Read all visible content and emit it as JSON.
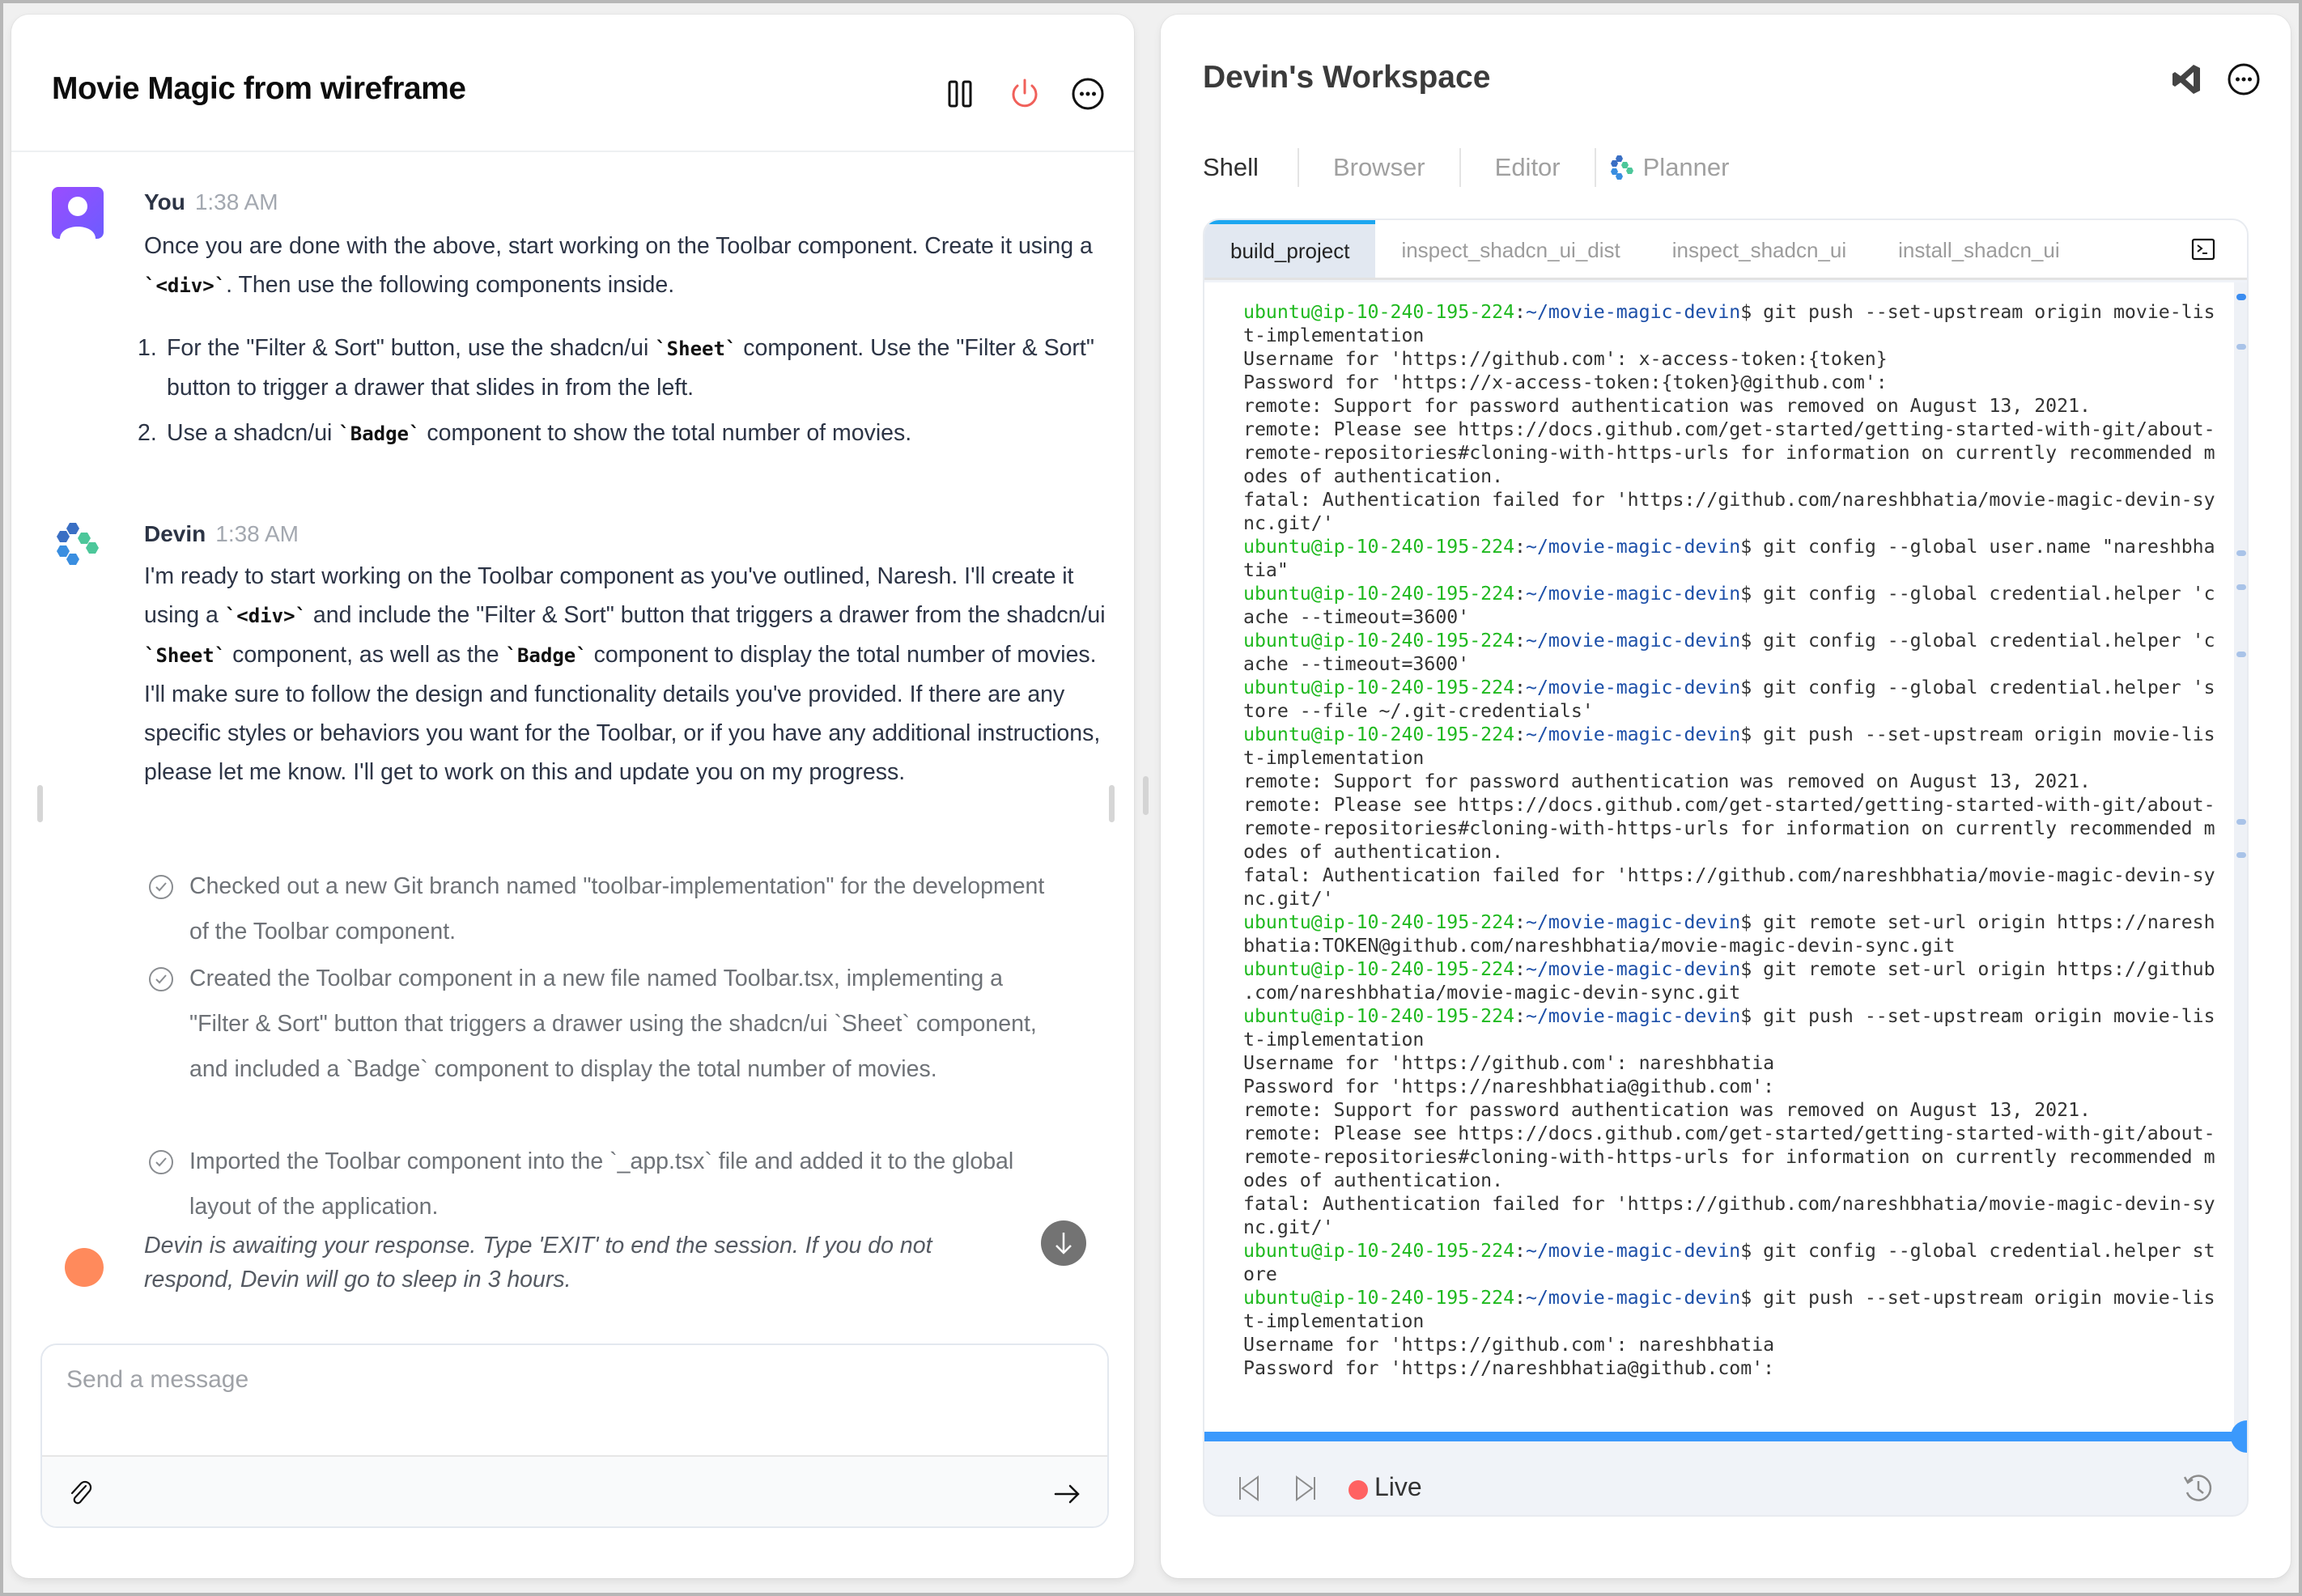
{
  "left": {
    "title": "Movie Magic from wireframe",
    "icons": {
      "pause": "pause-icon",
      "power": "power-icon",
      "more": "more-icon"
    },
    "messages": [
      {
        "author": "You",
        "time": "1:38 AM",
        "avatar": "user-avatar",
        "text_parts": [
          "Once you are done with the above, start working on the Toolbar component. Create it using a ",
          "`<div>`",
          ". Then use the following components inside."
        ],
        "list": [
          {
            "num": "1.",
            "parts": [
              "For the \"Filter & Sort\" button, use the shadcn/ui ",
              "`Sheet`",
              " component. Use the \"Filter & Sort\" button to trigger a drawer that slides in from the left."
            ]
          },
          {
            "num": "2.",
            "parts": [
              "Use a shadcn/ui ",
              "`Badge`",
              " component to show the total number of movies."
            ]
          }
        ]
      },
      {
        "author": "Devin",
        "time": "1:38 AM",
        "avatar": "devin-logo",
        "text_parts": [
          "I'm ready to start working on the Toolbar component as you've outlined, Naresh. I'll create it using a ",
          "`<div>`",
          " and include the \"Filter & Sort\" button that triggers a drawer from the shadcn/ui ",
          "`Sheet`",
          " component, as well as the ",
          "`Badge`",
          " component to display the total number of movies. I'll make sure to follow the design and functionality details you've provided. If there are any specific styles or behaviors you want for the Toolbar, or if you have any additional instructions, please let me know. I'll get to work on this and update you on my progress."
        ],
        "steps": [
          "Checked out a new Git branch named \"toolbar-implementation\" for the development of the Toolbar component.",
          "Created the Toolbar component in a new file named Toolbar.tsx, implementing a \"Filter & Sort\" button that triggers a drawer using the shadcn/ui `Sheet` component, and included a `Badge` component to display the total number of movies.",
          "Imported the Toolbar component into the `_app.tsx` file and added it to the global layout of the application."
        ]
      }
    ],
    "awaiting_text": "Devin is awaiting your response. Type 'EXIT' to end the session. If you do not respond, Devin will go to sleep in 3 hours.",
    "composer": {
      "placeholder": "Send a message",
      "value": ""
    }
  },
  "right": {
    "title": "Devin's Workspace",
    "icons": {
      "vscode": "vscode-icon",
      "more": "more-icon"
    },
    "tabs": [
      {
        "label": "Shell",
        "active": true
      },
      {
        "label": "Browser",
        "active": false
      },
      {
        "label": "Editor",
        "active": false
      },
      {
        "label": "Planner",
        "active": false,
        "icon": "planner-icon"
      }
    ],
    "session_tabs": [
      {
        "label": "build_project",
        "active": true
      },
      {
        "label": "inspect_shadcn_ui_dist",
        "active": false
      },
      {
        "label": "inspect_shadcn_ui",
        "active": false
      },
      {
        "label": "install_shadcn_ui",
        "active": false
      }
    ],
    "prompt": {
      "user": "ubuntu@ip-10-240-195-224",
      "path": "~/movie-magic-devin"
    },
    "terminal_lines": [
      {
        "cmd": "git push --set-upstream origin movie-lis"
      },
      {
        "out": "t-implementation"
      },
      {
        "out": "Username for 'https://github.com': x-access-token:{token}"
      },
      {
        "out": "Password for 'https://x-access-token:{token}@github.com':"
      },
      {
        "out": "remote: Support for password authentication was removed on August 13, 2021."
      },
      {
        "out": "remote: Please see https://docs.github.com/get-started/getting-started-with-git/about-"
      },
      {
        "out": "remote-repositories#cloning-with-https-urls for information on currently recommended m"
      },
      {
        "out": "odes of authentication."
      },
      {
        "out": "fatal: Authentication failed for 'https://github.com/nareshbhatia/movie-magic-devin-sy"
      },
      {
        "out": "nc.git/'"
      },
      {
        "cmd": "git config --global user.name \"nareshbha"
      },
      {
        "out": "tia\""
      },
      {
        "cmd": "git config --global credential.helper 'c"
      },
      {
        "out": "ache --timeout=3600'"
      },
      {
        "cmd": "git config --global credential.helper 'c"
      },
      {
        "out": "ache --timeout=3600'"
      },
      {
        "cmd": "git config --global credential.helper 's"
      },
      {
        "out": "tore --file ~/.git-credentials'"
      },
      {
        "cmd": "git push --set-upstream origin movie-lis"
      },
      {
        "out": "t-implementation"
      },
      {
        "out": "remote: Support for password authentication was removed on August 13, 2021."
      },
      {
        "out": "remote: Please see https://docs.github.com/get-started/getting-started-with-git/about-"
      },
      {
        "out": "remote-repositories#cloning-with-https-urls for information on currently recommended m"
      },
      {
        "out": "odes of authentication."
      },
      {
        "out": "fatal: Authentication failed for 'https://github.com/nareshbhatia/movie-magic-devin-sy"
      },
      {
        "out": "nc.git/'"
      },
      {
        "cmd": "git remote set-url origin https://naresh"
      },
      {
        "out": "bhatia:TOKEN@github.com/nareshbhatia/movie-magic-devin-sync.git"
      },
      {
        "cmd": "git remote set-url origin https://github"
      },
      {
        "out": ".com/nareshbhatia/movie-magic-devin-sync.git"
      },
      {
        "cmd": "git push --set-upstream origin movie-lis"
      },
      {
        "out": "t-implementation"
      },
      {
        "out": "Username for 'https://github.com': nareshbhatia"
      },
      {
        "out": "Password for 'https://nareshbhatia@github.com':"
      },
      {
        "out": "remote: Support for password authentication was removed on August 13, 2021."
      },
      {
        "out": "remote: Please see https://docs.github.com/get-started/getting-started-with-git/about-"
      },
      {
        "out": "remote-repositories#cloning-with-https-urls for information on currently recommended m"
      },
      {
        "out": "odes of authentication."
      },
      {
        "out": "fatal: Authentication failed for 'https://github.com/nareshbhatia/movie-magic-devin-sy"
      },
      {
        "out": "nc.git/'"
      },
      {
        "cmd": "git config --global credential.helper st"
      },
      {
        "out": "ore"
      },
      {
        "cmd": "git push --set-upstream origin movie-lis"
      },
      {
        "out": "t-implementation"
      },
      {
        "out": "Username for 'https://github.com': nareshbhatia"
      },
      {
        "out": "Password for 'https://nareshbhatia@github.com':"
      }
    ],
    "scroll_markers": [
      0.0,
      0.045,
      0.23,
      0.26,
      0.32,
      0.47,
      0.5
    ],
    "playback": {
      "progress": 1.0,
      "live_label": "Live"
    },
    "colors": {
      "accent": "#3b99fc",
      "live": "#ff6262",
      "prompt_user": "#1fb91f",
      "prompt_path": "#1c4fa8"
    }
  }
}
